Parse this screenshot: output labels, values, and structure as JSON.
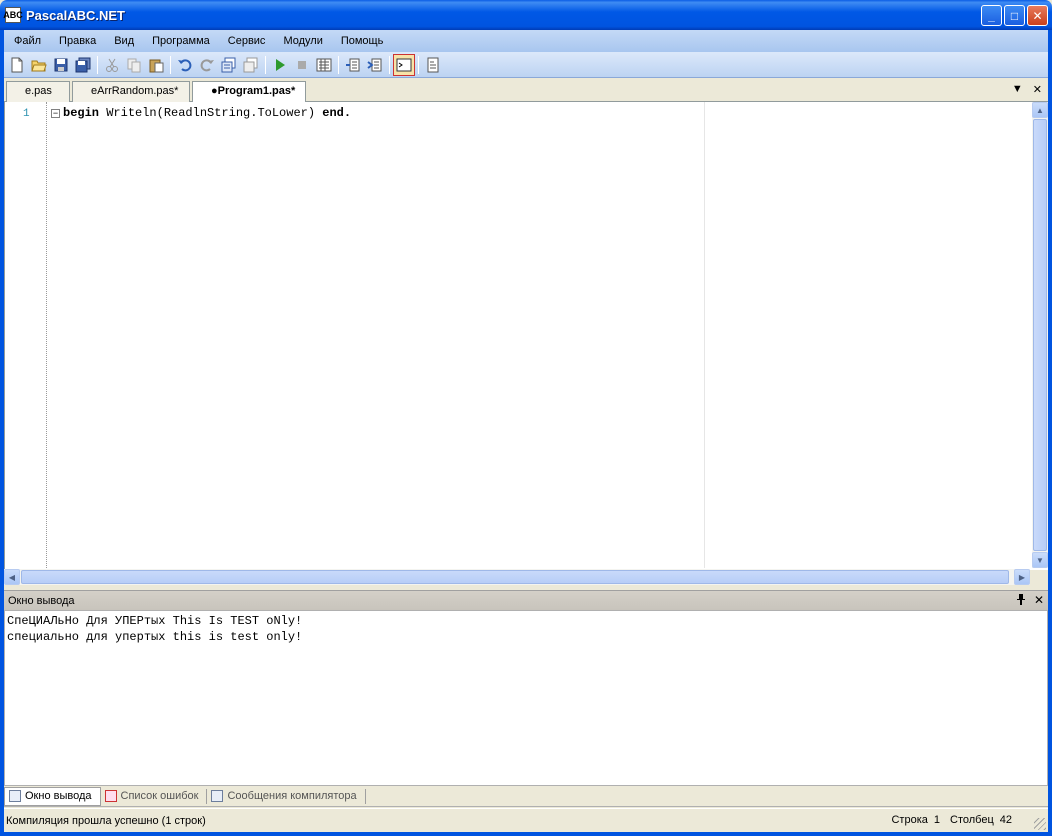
{
  "window": {
    "title": "PascalABC.NET",
    "icon_label": "ABC",
    "minimize": "_",
    "maximize": "□",
    "close": "✕"
  },
  "menu": [
    "Файл",
    "Правка",
    "Вид",
    "Программа",
    "Сервис",
    "Модули",
    "Помощь"
  ],
  "toolbar": {
    "icons": [
      "new-icon",
      "open-icon",
      "save-icon",
      "save-all-icon",
      "cut-icon",
      "copy-icon",
      "paste-icon",
      "undo-icon",
      "redo-icon",
      "comment-icon",
      "uncomment-icon",
      "run-icon",
      "stop-icon",
      "compile-icon",
      "step-in-icon",
      "step-over-icon",
      "output-window-icon",
      "form-designer-icon"
    ]
  },
  "tabs": [
    {
      "label": "e.pas",
      "active": false
    },
    {
      "label": "eArrRandom.pas*",
      "active": false
    },
    {
      "label": "●Program1.pas*",
      "active": true
    }
  ],
  "tab_controls": {
    "dropdown": "▼",
    "close": "✕"
  },
  "editor": {
    "line_number": "1",
    "fold_marker": "−",
    "code": {
      "kw_begin": "begin",
      "body": " Writeln(ReadlnString.ToLower) ",
      "kw_end": "end."
    }
  },
  "output": {
    "header": "Окно вывода",
    "pin": "ꟸ",
    "close": "✕",
    "lines": [
      "СпеЦИАЛьНо Для УПЕРтых This Is TEST oNly!",
      "специально для упертых this is test only!"
    ]
  },
  "bottom_tabs": [
    {
      "label": "Окно вывода",
      "active": true
    },
    {
      "label": "Список ошибок",
      "active": false
    },
    {
      "label": "Сообщения компилятора",
      "active": false
    }
  ],
  "status": {
    "message": "Компиляция прошла успешно (1 строк)",
    "row_label": "Строка",
    "row_value": "1",
    "col_label": "Столбец",
    "col_value": "42"
  }
}
